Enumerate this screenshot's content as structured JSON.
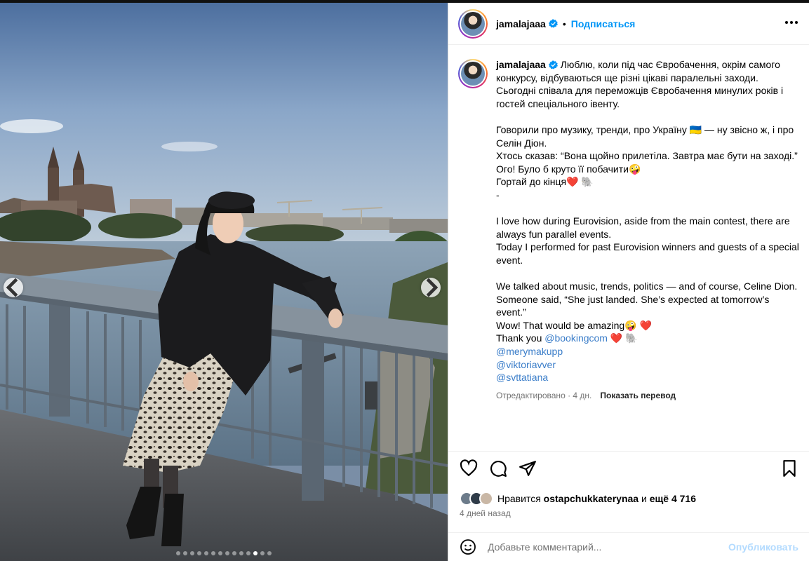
{
  "post": {
    "username": "jamalajaaa",
    "follow_label": "Подписаться",
    "separator": "•",
    "caption_lines": [
      {
        "text": "Люблю, коли під час Євробачення, окрім самого конкурсу, відбуваються ще різні цікаві паралельні заходи. Сьогодні співала для переможців Євробачення минулих років і гостей спеціального івенту."
      },
      {
        "text": ""
      },
      {
        "text": "Говорили про музику, тренди, про Україну 🇺🇦 — ну звісно ж, і про Селін Діон."
      },
      {
        "text": "Хтось сказав: “Вона щойно прилетіла. Завтра має бути на заході.”"
      },
      {
        "text": "Ого! Було б круто її побачити🤪"
      },
      {
        "text": "Гортай до кінця❤️ 🐘"
      },
      {
        "text": "-"
      },
      {
        "text": ""
      },
      {
        "text": "I love how during Eurovision, aside from the main contest, there are always fun parallel events."
      },
      {
        "text": "Today I performed for past Eurovision winners and guests of a special event."
      },
      {
        "text": ""
      },
      {
        "text": "We talked about music, trends, politics — and of course, Celine Dion."
      },
      {
        "text": "Someone said, “She just landed. She’s expected at tomorrow’s event.”"
      },
      {
        "text": "Wow! That would be amazing🤪 ❤️"
      }
    ],
    "thanks_prefix": "Thank you ",
    "thanks_mention": "@bookingcom",
    "thanks_suffix": " ❤️ 🐘",
    "mentions": [
      "@merymakupp",
      "@viktoriavver",
      "@svttatiana"
    ],
    "edited_label": "Отредактировано · 4 дн.",
    "translate_label": "Показать перевод",
    "likes_prefix": "Нравится ",
    "likes_user": "ostapchukkaterynaa",
    "likes_and": " и ",
    "likes_more": "ещё 4 716",
    "time_label": "4 дней назад",
    "comment_placeholder": "Добавьте комментарий...",
    "publish_label": "Опубликовать"
  },
  "carousel": {
    "slide_count": 14,
    "active_index": 11
  },
  "icons": {
    "verified": "verified-badge-icon",
    "like": "heart-icon",
    "comment": "comment-icon",
    "share": "share-icon",
    "save": "bookmark-icon",
    "emoji": "emoji-icon",
    "more": "more-options-icon",
    "prev": "chevron-left-icon",
    "next": "chevron-right-icon"
  },
  "colors": {
    "accent": "#0095f6",
    "verified": "#0095f6",
    "mention": "#3a7dc9",
    "heart": "#ed4956",
    "muted": "#737373"
  }
}
